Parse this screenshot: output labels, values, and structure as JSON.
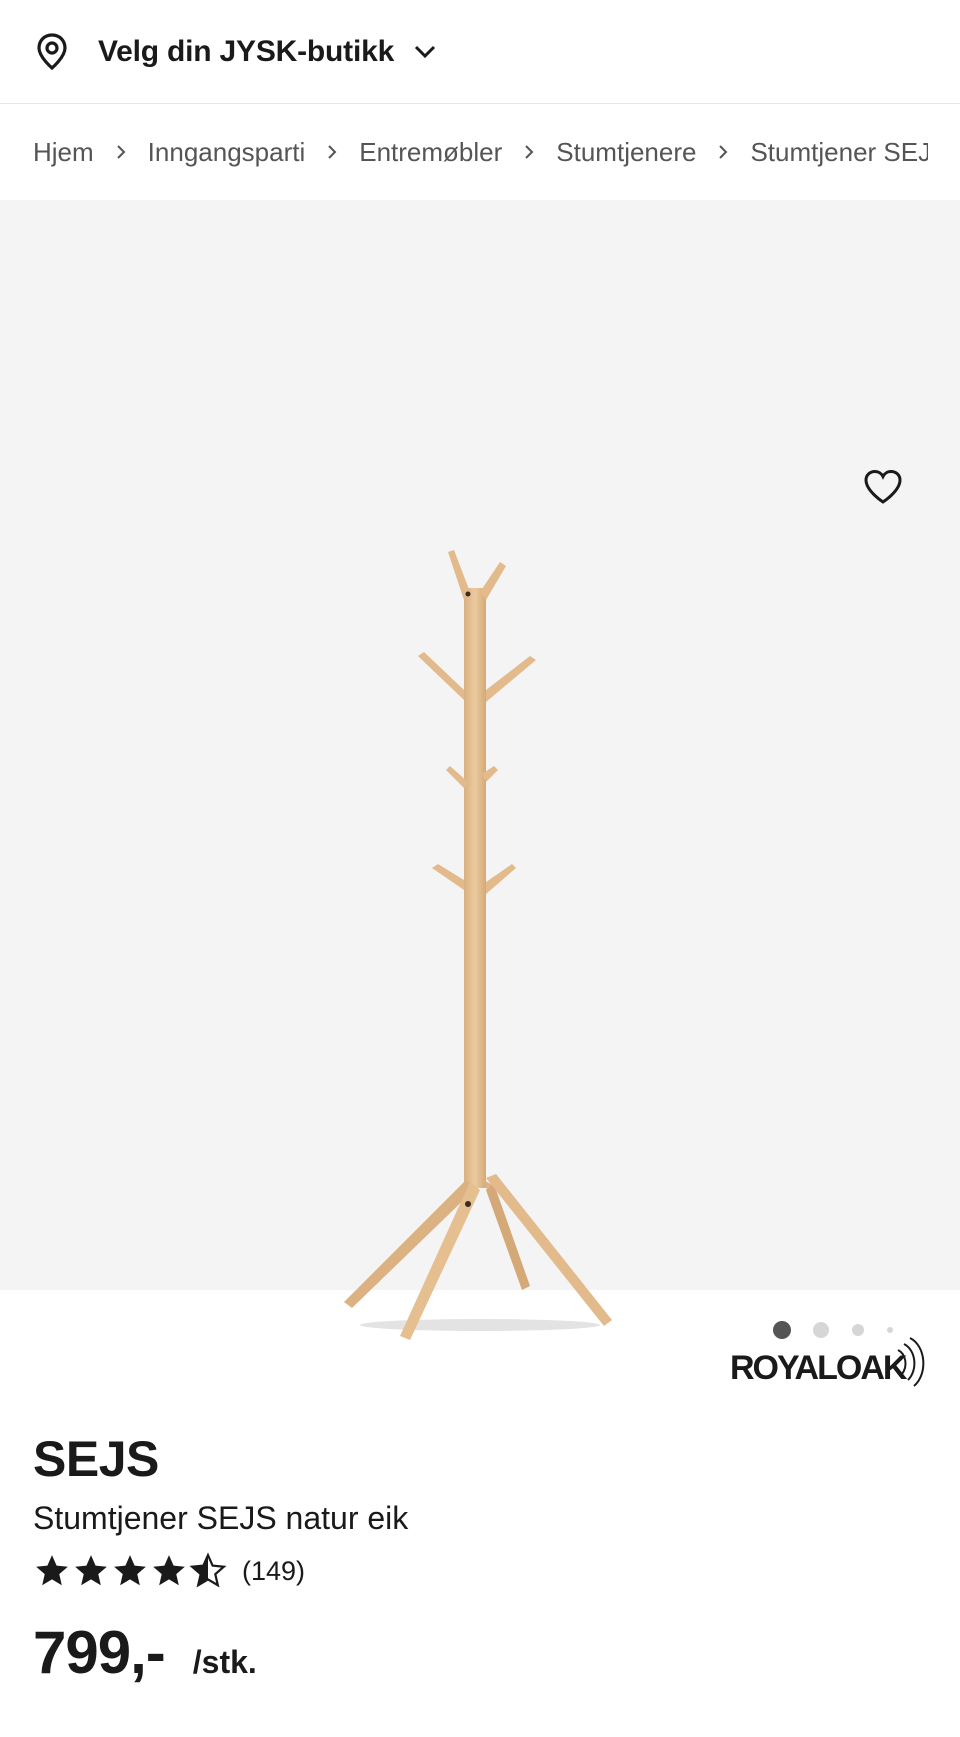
{
  "store_bar": {
    "label": "Velg din JYSK-butikk",
    "icon": "location-pin-icon"
  },
  "breadcrumb": [
    "Hjem",
    "Inngangsparti",
    "Entremøbler",
    "Stumtjenere",
    "Stumtjener SEJS"
  ],
  "gallery": {
    "image_count": 4,
    "active_index": 0,
    "background": "#f4f4f4"
  },
  "product": {
    "brand_logo": "ROYALOAK",
    "name": "SEJS",
    "description": "Stumtjener SEJS natur eik",
    "rating": 4.5,
    "review_count": "(149)",
    "price": "799,-",
    "unit": "/stk."
  },
  "colors": {
    "wood": "#e7c49a",
    "text": "#1a1a1a",
    "muted": "#555555"
  }
}
